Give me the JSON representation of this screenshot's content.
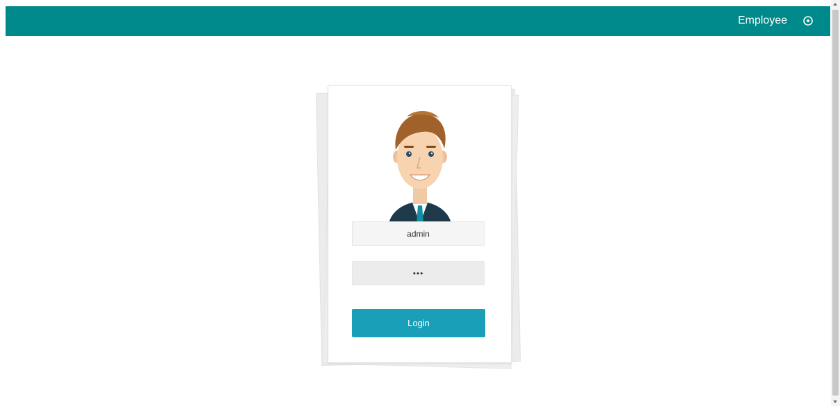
{
  "header": {
    "title": "Employee",
    "help_icon": "question-circle-icon"
  },
  "login": {
    "avatar_icon": "employee-avatar-illustration",
    "username_value": "admin",
    "password_value": "•••",
    "login_label": "Login"
  },
  "colors": {
    "header_bg": "#00898a",
    "button_bg": "#1a9fb8"
  }
}
